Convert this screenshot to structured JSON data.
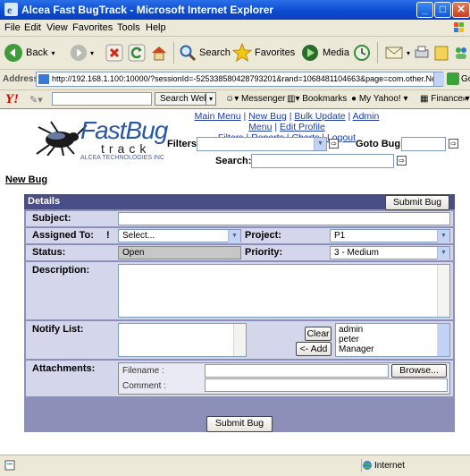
{
  "window": {
    "title": "Alcea Fast BugTrack - Microsoft Internet Explorer"
  },
  "menu": [
    "File",
    "Edit",
    "View",
    "Favorites",
    "Tools",
    "Help"
  ],
  "toolbar": {
    "back": "Back",
    "search": "Search",
    "favorites": "Favorites",
    "media": "Media"
  },
  "address": {
    "label": "Address",
    "url": "http://192.168.1.100:10000/?sessionId=-525338580428793201&rand=1068481104663&page=com.other.Ne",
    "go": "Go"
  },
  "yahoo": {
    "search_web": "Search Web",
    "messenger": "Messenger",
    "bookmarks": "Bookmarks",
    "my_yahoo": "My Yahoo!",
    "finance": "Finance",
    "more": "»"
  },
  "logo": {
    "fast": "FastBug",
    "track": "track",
    "alcea": "ALCEA TECHNOLOGIES INC"
  },
  "nav": {
    "links1": [
      "Main Menu",
      "New Bug",
      "Bulk Update",
      "Admin Menu",
      "Edit Profile"
    ],
    "links2": [
      "Filters",
      "Reports",
      "Charts",
      "Logout"
    ],
    "separator": "|"
  },
  "header_form": {
    "filters_label": "Filters:",
    "goto_label": "Goto Bug:",
    "search_label": "Search:"
  },
  "page": {
    "heading": "New Bug"
  },
  "panel": {
    "title": "Details",
    "submit_top": "Submit Bug",
    "subject_label": "Subject:",
    "assigned_label": "Assigned To:",
    "assigned_marker": "!",
    "assigned_value": "Select...",
    "project_label": "Project:",
    "project_value": "P1",
    "status_label": "Status:",
    "status_value": "Open",
    "priority_label": "Priority:",
    "priority_value": "3 - Medium",
    "description_label": "Description:",
    "notify_label": "Notify List:",
    "clear_button": "Clear",
    "add_button": "<- Add",
    "notify_options": [
      "admin",
      "peter",
      "Manager"
    ],
    "attachments_label": "Attachments:",
    "filename_label": "Filename :",
    "comment_label": "Comment :",
    "browse_button": "Browse..."
  },
  "footer": {
    "submit_bottom": "Submit Bug"
  },
  "statusbar": {
    "zone": "Internet"
  },
  "colors": {
    "panel_header": "#4a4e86",
    "panel_row": "#d4d6ec",
    "link": "#1a3ca8"
  }
}
